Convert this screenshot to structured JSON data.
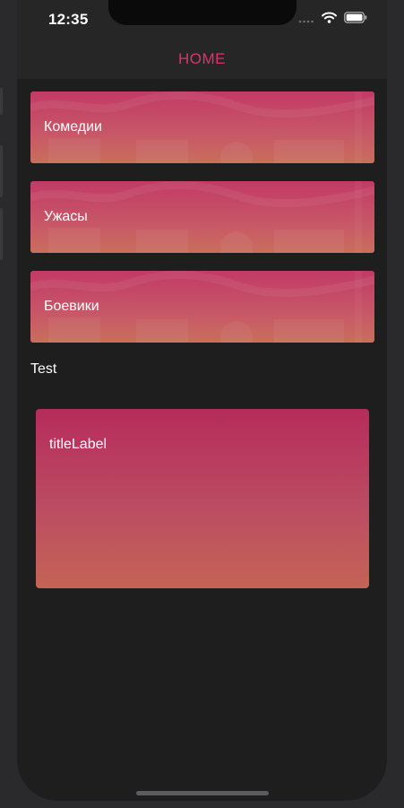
{
  "status_bar": {
    "time": "12:35",
    "icons": [
      "cellular-signal-icon",
      "wifi-icon",
      "battery-icon"
    ]
  },
  "nav": {
    "title": "HOME"
  },
  "categories": [
    {
      "label": "Комедии"
    },
    {
      "label": "Ужасы"
    },
    {
      "label": "Боевики"
    }
  ],
  "section": {
    "title": "Test"
  },
  "featured": {
    "title": "titleLabel"
  },
  "colors": {
    "accent": "#e2306c",
    "background": "#1e1e1f",
    "card_gradient_top": "#c23a66",
    "card_gradient_bottom": "#c96e5c"
  }
}
